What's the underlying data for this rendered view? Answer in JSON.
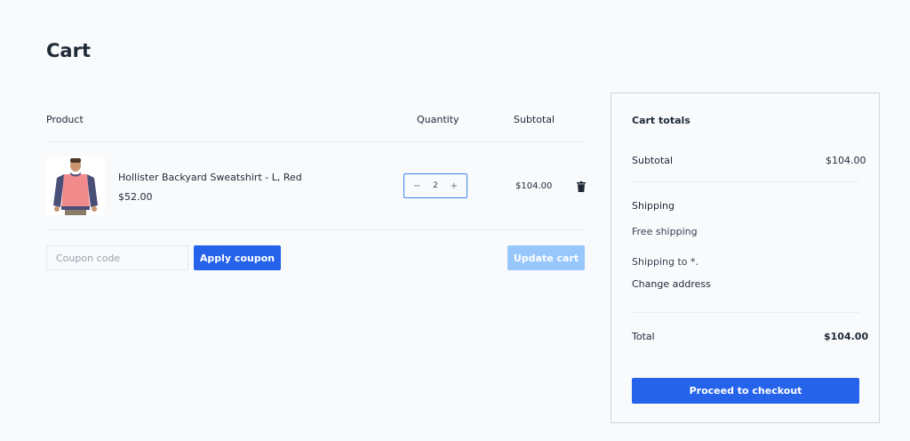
{
  "page": {
    "title": "Cart"
  },
  "table": {
    "headers": {
      "product": "Product",
      "quantity": "Quantity",
      "subtotal": "Subtotal"
    }
  },
  "items": [
    {
      "name": "Hollister Backyard Sweatshirt - L, Red",
      "price": "$52.00",
      "quantity": "2",
      "subtotal": "$104.00",
      "minus": "−",
      "plus": "+"
    }
  ],
  "coupon": {
    "placeholder": "Coupon code",
    "value": "",
    "apply_label": "Apply coupon"
  },
  "actions": {
    "update_label": "Update cart"
  },
  "totals": {
    "title": "Cart totals",
    "subtotal_label": "Subtotal",
    "subtotal_value": "$104.00",
    "shipping_label": "Shipping",
    "shipping_method": "Free shipping",
    "shipping_to": "Shipping to *.",
    "change_address": "Change address",
    "total_label": "Total",
    "total_value": "$104.00",
    "checkout_label": "Proceed to checkout"
  },
  "colors": {
    "accent": "#2563eb",
    "accent_disabled": "#93c5fd",
    "background": "#f8fafc",
    "text": "#1f2937"
  }
}
